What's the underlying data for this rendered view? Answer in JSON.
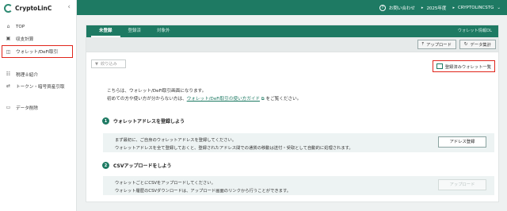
{
  "brand": {
    "name": "CryptoLinC"
  },
  "sidebar": {
    "items": [
      {
        "label": "TOP",
        "icon": "home-icon",
        "glyph": "⌂"
      },
      {
        "label": "収支計算",
        "icon": "calculator-icon",
        "glyph": "▣"
      },
      {
        "label": "ウォレット/DeFi取引",
        "icon": "wallet-icon",
        "glyph": "◫"
      },
      {
        "label": "税理士紹介",
        "icon": "people-icon",
        "glyph": "☷"
      },
      {
        "label": "トークン・暗号資産引取",
        "icon": "swap-icon",
        "glyph": "⇄"
      },
      {
        "label": "データ削除",
        "icon": "delete-icon",
        "glyph": "▭"
      }
    ]
  },
  "topbar": {
    "help": "お問い合わせ",
    "year": "2025年度",
    "account": "CRYPTOLINCSTG"
  },
  "panel": {
    "tabs": [
      "未登録",
      "登録済",
      "対象外"
    ],
    "right_label": "ウォレット情報DL",
    "toolbar": {
      "upload": "アップロード",
      "aggregate": "データ集計"
    },
    "filter": "絞り込み",
    "list_button": "登録済みウォレット一覧",
    "intro_line1": "こちらは、ウォレット/DeFi取引画面になります。",
    "intro_line2a": "初めての方や使い方が分からない方は、",
    "intro_link": "ウォレット/DeFi取引の使い方ガイド",
    "intro_line2b": "をご覧ください。",
    "steps": [
      {
        "num": "1",
        "title": "ウォレットアドレスを登録しよう",
        "line1": "まず最初に、ご自身のウォレットアドレスを登録してください。",
        "line2": "ウォレットアドレスを全て登録しておくと、登録されたアドレス間での通貨の移動は送付・受取として自動的に処理されます。",
        "button": "アドレス登録"
      },
      {
        "num": "2",
        "title": "CSVアップロードをしよう",
        "line1": "ウォレットごとにCSVをアップロードしてください。",
        "line2": "ウォレット履歴のCSVダウンロードは、アップロード画面のリンクから行うことができます。",
        "button": "アップロード"
      }
    ]
  }
}
